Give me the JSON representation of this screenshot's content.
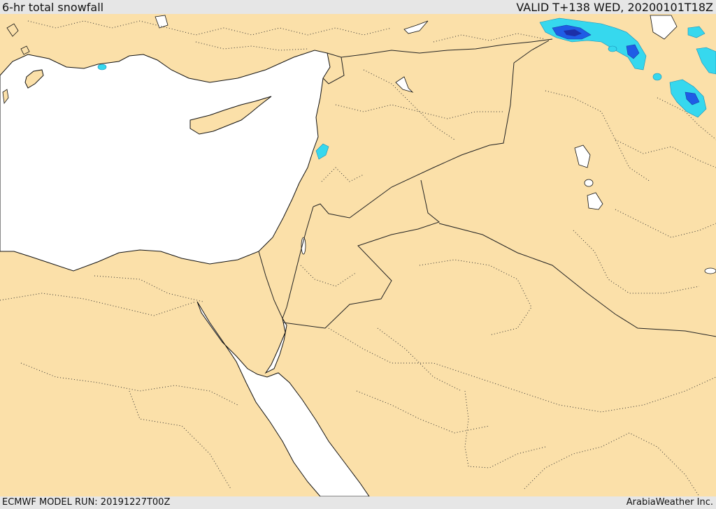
{
  "header": {
    "title": "6-hr total snowfall",
    "valid": "VALID T+138 WED, 20200101T18Z"
  },
  "footer": {
    "model_run": "ECMWF MODEL RUN: 20191227T00Z",
    "credit": "ArabiaWeather Inc."
  },
  "map": {
    "land_color": "#fbe0a9",
    "water_color": "#ffffff",
    "border_color": "#222222",
    "snow_levels": [
      {
        "level": "light",
        "color": "#36d8ee"
      },
      {
        "level": "moderate",
        "color": "#1f5ce6"
      },
      {
        "level": "heavy",
        "color": "#1c2fa8"
      }
    ]
  }
}
